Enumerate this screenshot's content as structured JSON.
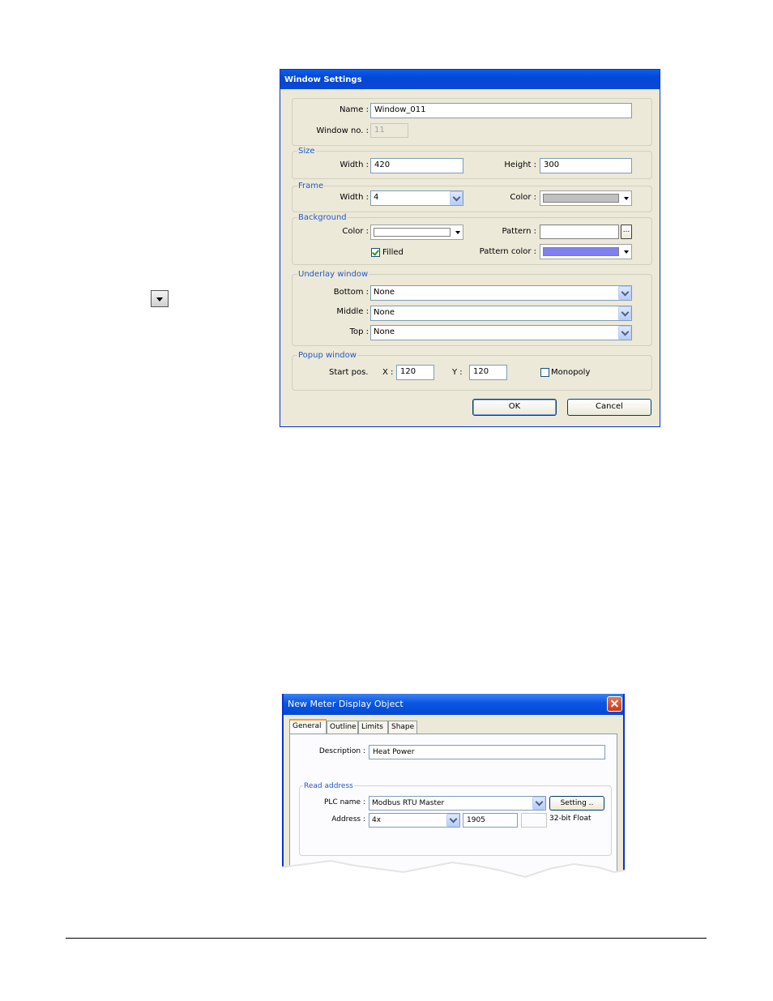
{
  "window_settings": {
    "title": "Window Settings",
    "name_label": "Name :",
    "name_value": "Window_011",
    "window_no_label": "Window no. :",
    "window_no_value": "11",
    "size": {
      "title": "Size",
      "width_label": "Width :",
      "width_value": "420",
      "height_label": "Height :",
      "height_value": "300"
    },
    "frame": {
      "title": "Frame",
      "width_label": "Width :",
      "width_value": "4",
      "color_label": "Color :",
      "color_value": "#c0c0c0"
    },
    "background": {
      "title": "Background",
      "color_label": "Color :",
      "color_value": "#ffffff",
      "pattern_label": "Pattern :",
      "pattern_button": "...",
      "filled_label": "Filled",
      "pattern_color_label": "Pattern color :",
      "pattern_color_value": "#8080f0"
    },
    "underlay": {
      "title": "Underlay window",
      "bottom_label": "Bottom :",
      "bottom_value": "None",
      "middle_label": "Middle :",
      "middle_value": "None",
      "top_label": "Top :",
      "top_value": "None"
    },
    "popup": {
      "title": "Popup window",
      "start_label": "Start pos.",
      "x_label": "X :",
      "x_value": "120",
      "y_label": "Y :",
      "y_value": "120",
      "monopoly_label": "Monopoly"
    },
    "ok_label": "OK",
    "cancel_label": "Cancel"
  },
  "meter_dialog": {
    "title": "New  Meter Display Object",
    "tabs": [
      "General",
      "Outline",
      "Limits",
      "Shape"
    ],
    "description_label": "Description :",
    "description_value": "Heat Power",
    "read_address": {
      "title": "Read address",
      "plc_label": "PLC name :",
      "plc_value": "Modbus RTU Master",
      "setting_button": "Setting ..",
      "address_label": "Address :",
      "address_type": "4x",
      "address_value": "1905",
      "data_format": "32-bit Float"
    }
  }
}
